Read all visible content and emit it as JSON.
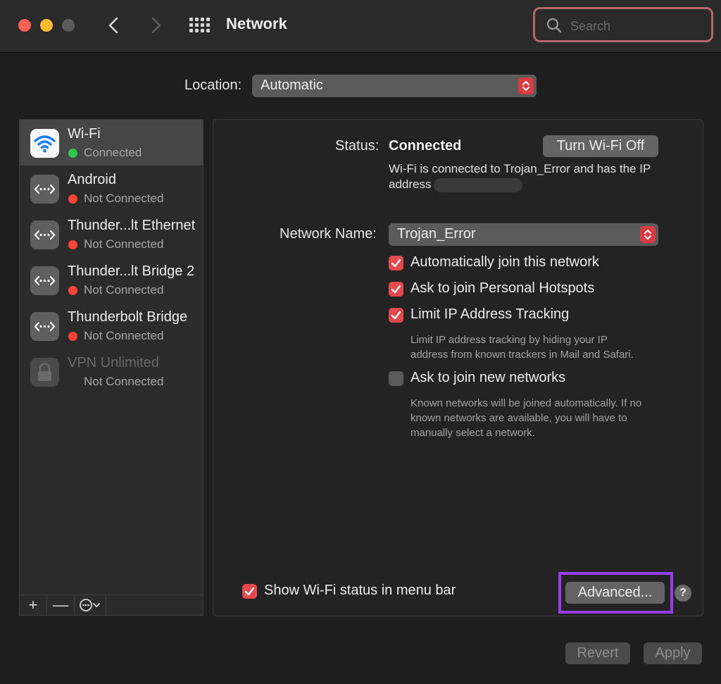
{
  "window": {
    "title": "Network",
    "search_placeholder": "Search"
  },
  "location": {
    "label": "Location:",
    "value": "Automatic"
  },
  "services": [
    {
      "name": "Wi-Fi",
      "status": "Connected",
      "status_color": "#2fc54b",
      "icon": "wifi-icon",
      "selected": true
    },
    {
      "name": "Android",
      "status": "Not Connected",
      "status_color": "#ff453a",
      "icon": "ethernet-icon"
    },
    {
      "name": "Thunder...lt Ethernet",
      "status": "Not Connected",
      "status_color": "#ff453a",
      "icon": "ethernet-icon"
    },
    {
      "name": "Thunder...lt Bridge 2",
      "status": "Not Connected",
      "status_color": "#ff453a",
      "icon": "ethernet-icon"
    },
    {
      "name": "Thunderbolt Bridge",
      "status": "Not Connected",
      "status_color": "#ff453a",
      "icon": "ethernet-icon"
    },
    {
      "name": "VPN Unlimited",
      "status": "Not Connected",
      "icon": "lock-icon",
      "disabled": true
    }
  ],
  "sidebar_toolbar": {
    "add": "+",
    "remove": "—",
    "action": "⊙⌄"
  },
  "detail": {
    "status_label": "Status:",
    "status_value": "Connected",
    "turn_off_button": "Turn Wi-Fi Off",
    "status_description": "Wi-Fi is connected to Trojan_Error and has the IP address",
    "network_name_label": "Network Name:",
    "network_name_value": "Trojan_Error",
    "options": [
      {
        "label": "Automatically join this network",
        "checked": true
      },
      {
        "label": "Ask to join Personal Hotspots",
        "checked": true
      },
      {
        "label": "Limit IP Address Tracking",
        "checked": true
      },
      {
        "label": "Ask to join new networks",
        "checked": false
      }
    ],
    "limit_tracking_help_line1": "Limit IP address tracking by hiding your IP",
    "limit_tracking_help_line2": "address from known trackers in Mail and Safari.",
    "new_networks_help_line1": "Known networks will be joined automatically. If no",
    "new_networks_help_line2": "known networks are available, you will have to",
    "new_networks_help_line3": "manually select a network.",
    "show_status_label": "Show Wi-Fi status in menu bar",
    "show_status_checked": true,
    "advanced_button": "Advanced...",
    "help_button": "?"
  },
  "footer": {
    "revert_button": "Revert",
    "apply_button": "Apply"
  },
  "colors": {
    "accent": "#e5484d",
    "highlight": "#9a3cf0",
    "search_focus": "#b4686e"
  }
}
